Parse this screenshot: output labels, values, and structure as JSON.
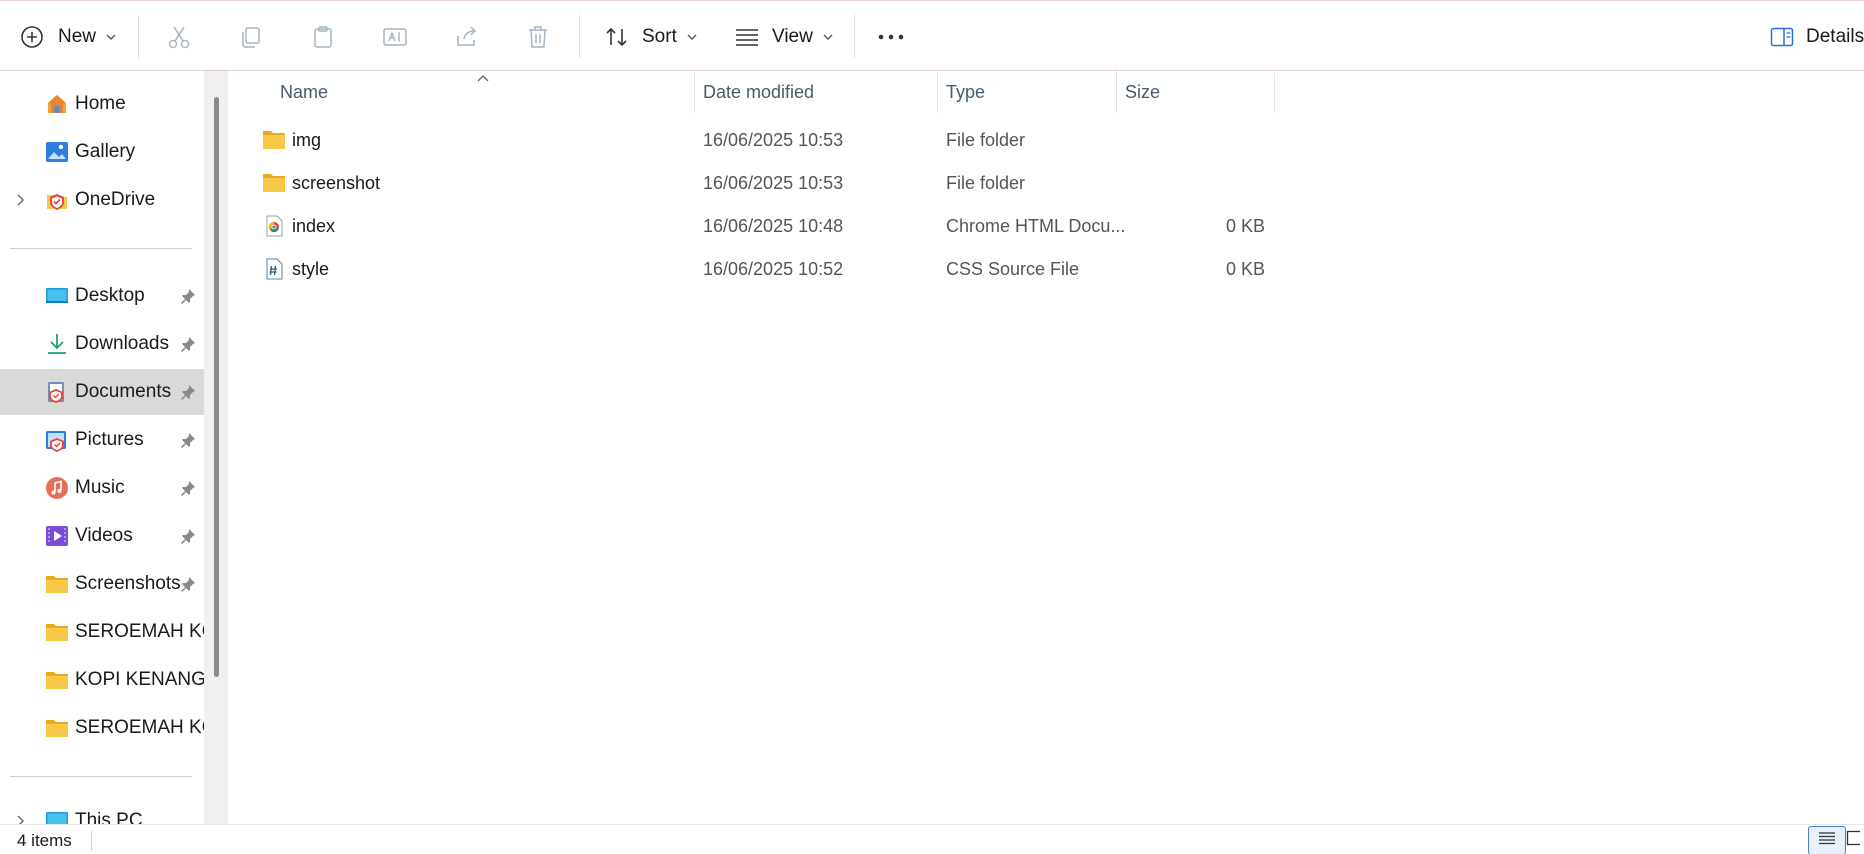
{
  "toolbar": {
    "new_label": "New",
    "sort_label": "Sort",
    "view_label": "View",
    "details_label": "Details"
  },
  "sidebar": {
    "items": [
      {
        "label": "Home",
        "icon": "home-icon"
      },
      {
        "label": "Gallery",
        "icon": "gallery-icon"
      },
      {
        "label": "OneDrive",
        "icon": "onedrive-icon"
      },
      {
        "label": "Desktop",
        "icon": "desktop-icon"
      },
      {
        "label": "Downloads",
        "icon": "downloads-icon"
      },
      {
        "label": "Documents",
        "icon": "documents-icon"
      },
      {
        "label": "Pictures",
        "icon": "pictures-icon"
      },
      {
        "label": "Music",
        "icon": "music-icon"
      },
      {
        "label": "Videos",
        "icon": "videos-icon"
      },
      {
        "label": "Screenshots",
        "icon": "folder-icon"
      },
      {
        "label": "SEROEMAH KOPI",
        "icon": "folder-icon"
      },
      {
        "label": "KOPI KENANGAN",
        "icon": "folder-icon"
      },
      {
        "label": "SEROEMAH KOPI",
        "icon": "folder-icon"
      },
      {
        "label": "This PC",
        "icon": "this-pc-icon"
      }
    ]
  },
  "columns": {
    "name": "Name",
    "date": "Date modified",
    "type": "Type",
    "size": "Size"
  },
  "files": [
    {
      "name": "img",
      "date": "16/06/2025 10:53",
      "type": "File folder",
      "size": "",
      "icon": "folder-icon"
    },
    {
      "name": "screenshot",
      "date": "16/06/2025 10:53",
      "type": "File folder",
      "size": "",
      "icon": "folder-icon"
    },
    {
      "name": "index",
      "date": "16/06/2025 10:48",
      "type": "Chrome HTML Docu...",
      "size": "0 KB",
      "icon": "chrome-html-icon"
    },
    {
      "name": "style",
      "date": "16/06/2025 10:52",
      "type": "CSS Source File",
      "size": "0 KB",
      "icon": "css-file-icon"
    }
  ],
  "status": {
    "item_count": "4 items"
  },
  "colors": {
    "accent": "#2b6fd6",
    "folder": "#f7c948",
    "selected_bg": "#d9d9d9"
  }
}
